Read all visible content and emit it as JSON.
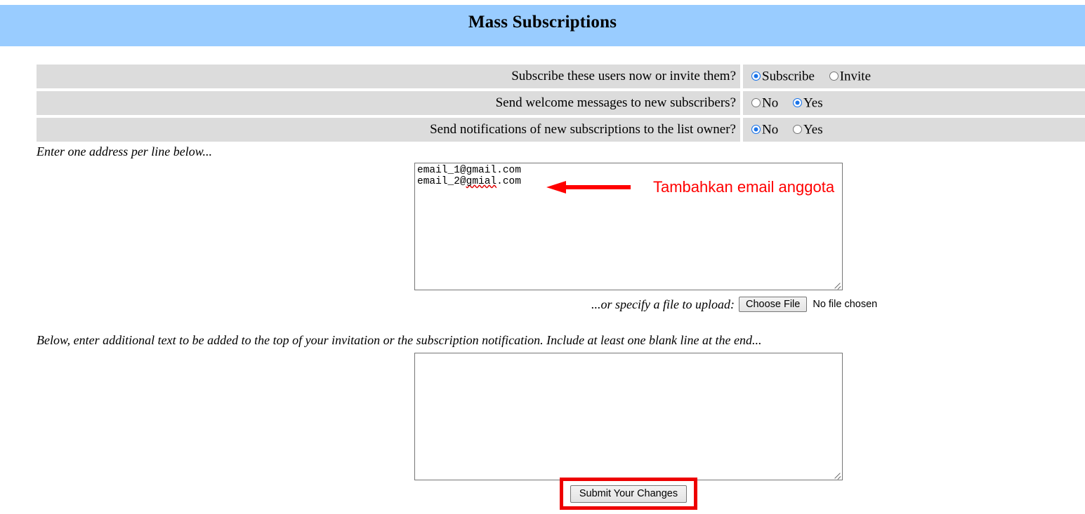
{
  "header": {
    "title": "Mass Subscriptions",
    "background_color": "#99ccff"
  },
  "options_table": {
    "rows": [
      {
        "label": "Subscribe these users now or invite them?",
        "options": [
          {
            "label": "Subscribe",
            "checked": true
          },
          {
            "label": "Invite",
            "checked": false
          }
        ]
      },
      {
        "label": "Send welcome messages to new subscribers?",
        "options": [
          {
            "label": "No",
            "checked": false
          },
          {
            "label": "Yes",
            "checked": true
          }
        ]
      },
      {
        "label": "Send notifications of new subscriptions to the list owner?",
        "options": [
          {
            "label": "No",
            "checked": true
          },
          {
            "label": "Yes",
            "checked": false
          }
        ]
      }
    ]
  },
  "addresses_section": {
    "hint": "Enter one address per line below...",
    "textarea_line_1": "email_1@gmail.com",
    "textarea_line_2_prefix": "email_2@",
    "textarea_line_2_misspelled": "gmial",
    "textarea_line_2_suffix": ".com",
    "placeholder": ""
  },
  "annotation": {
    "text": "Tambahkan email anggota",
    "color": "#ff0000",
    "arrow": "left-arrow-icon"
  },
  "upload": {
    "label": "...or specify a file to upload:",
    "button_label": "Choose File",
    "status": "No file chosen"
  },
  "body_section": {
    "hint": "Below, enter additional text to be added to the top of your invitation or the subscription notification. Include at least one blank line at the end...",
    "textarea_value": "",
    "placeholder": ""
  },
  "submit": {
    "label": "Submit Your Changes",
    "highlight_color": "#ee0000"
  }
}
